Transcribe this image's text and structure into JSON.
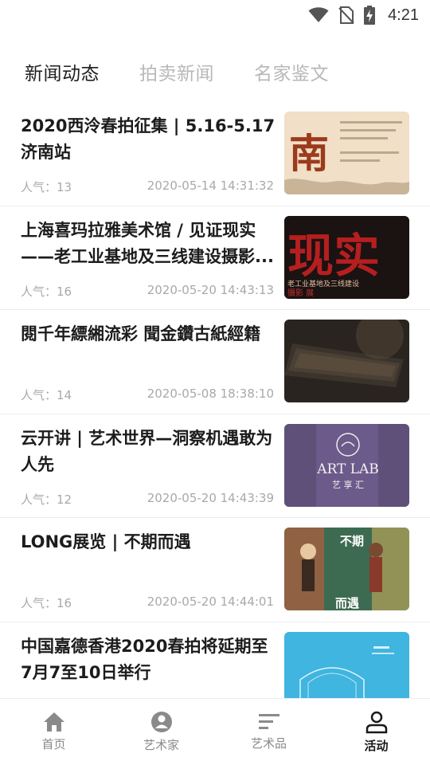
{
  "status_bar": {
    "time": "4:21",
    "icons": [
      "wifi-icon",
      "no-sim-icon",
      "battery-charging-icon"
    ]
  },
  "tabs": [
    {
      "label": "新闻动态",
      "active": true
    },
    {
      "label": "拍卖新闻",
      "active": false
    },
    {
      "label": "名家鉴文",
      "active": false
    }
  ],
  "news": [
    {
      "title": "2020西泠春拍征集 | 5.16-5.17济南站",
      "popularity_label": "人气：13",
      "datetime": "2020-05-14 14:31:32",
      "thumb_text": "南"
    },
    {
      "title": "上海喜玛拉雅美术馆 / 见证现实——老工业基地及三线建设摄影...",
      "popularity_label": "人气：16",
      "datetime": "2020-05-20 14:43:13",
      "thumb_text": "现实",
      "thumb_caption": "老工业基地及三线建设",
      "thumb_caption2": "摄影    展"
    },
    {
      "title": "閱千年縹緗流彩 聞金鑽古紙經籍",
      "popularity_label": "人气：14",
      "datetime": "2020-05-08 18:38:10"
    },
    {
      "title": "云开讲 | 艺术世界—洞察机遇敢为人先",
      "popularity_label": "人气：12",
      "datetime": "2020-05-20 14:43:39",
      "thumb_text": "ART LAB",
      "thumb_caption": "艺 享 汇"
    },
    {
      "title": "LONG展览 | 不期而遇",
      "popularity_label": "人气：16",
      "datetime": "2020-05-20 14:44:01",
      "thumb_text": "不期",
      "thumb_caption": "而遇"
    },
    {
      "title": "中国嘉德香港2020春拍将延期至7月7至10日举行",
      "popularity_label": "",
      "datetime": ""
    }
  ],
  "bottom_nav": [
    {
      "label": "首页",
      "icon": "home-icon",
      "active": false
    },
    {
      "label": "艺术家",
      "icon": "artist-icon",
      "active": false
    },
    {
      "label": "艺术品",
      "icon": "artwork-icon",
      "active": false
    },
    {
      "label": "活动",
      "icon": "activity-icon",
      "active": true
    }
  ],
  "colors": {
    "active_text": "#1f1f1f",
    "inactive_text": "#b8b8b8",
    "meta_text": "#a9a9a9",
    "divider": "#ececec"
  }
}
